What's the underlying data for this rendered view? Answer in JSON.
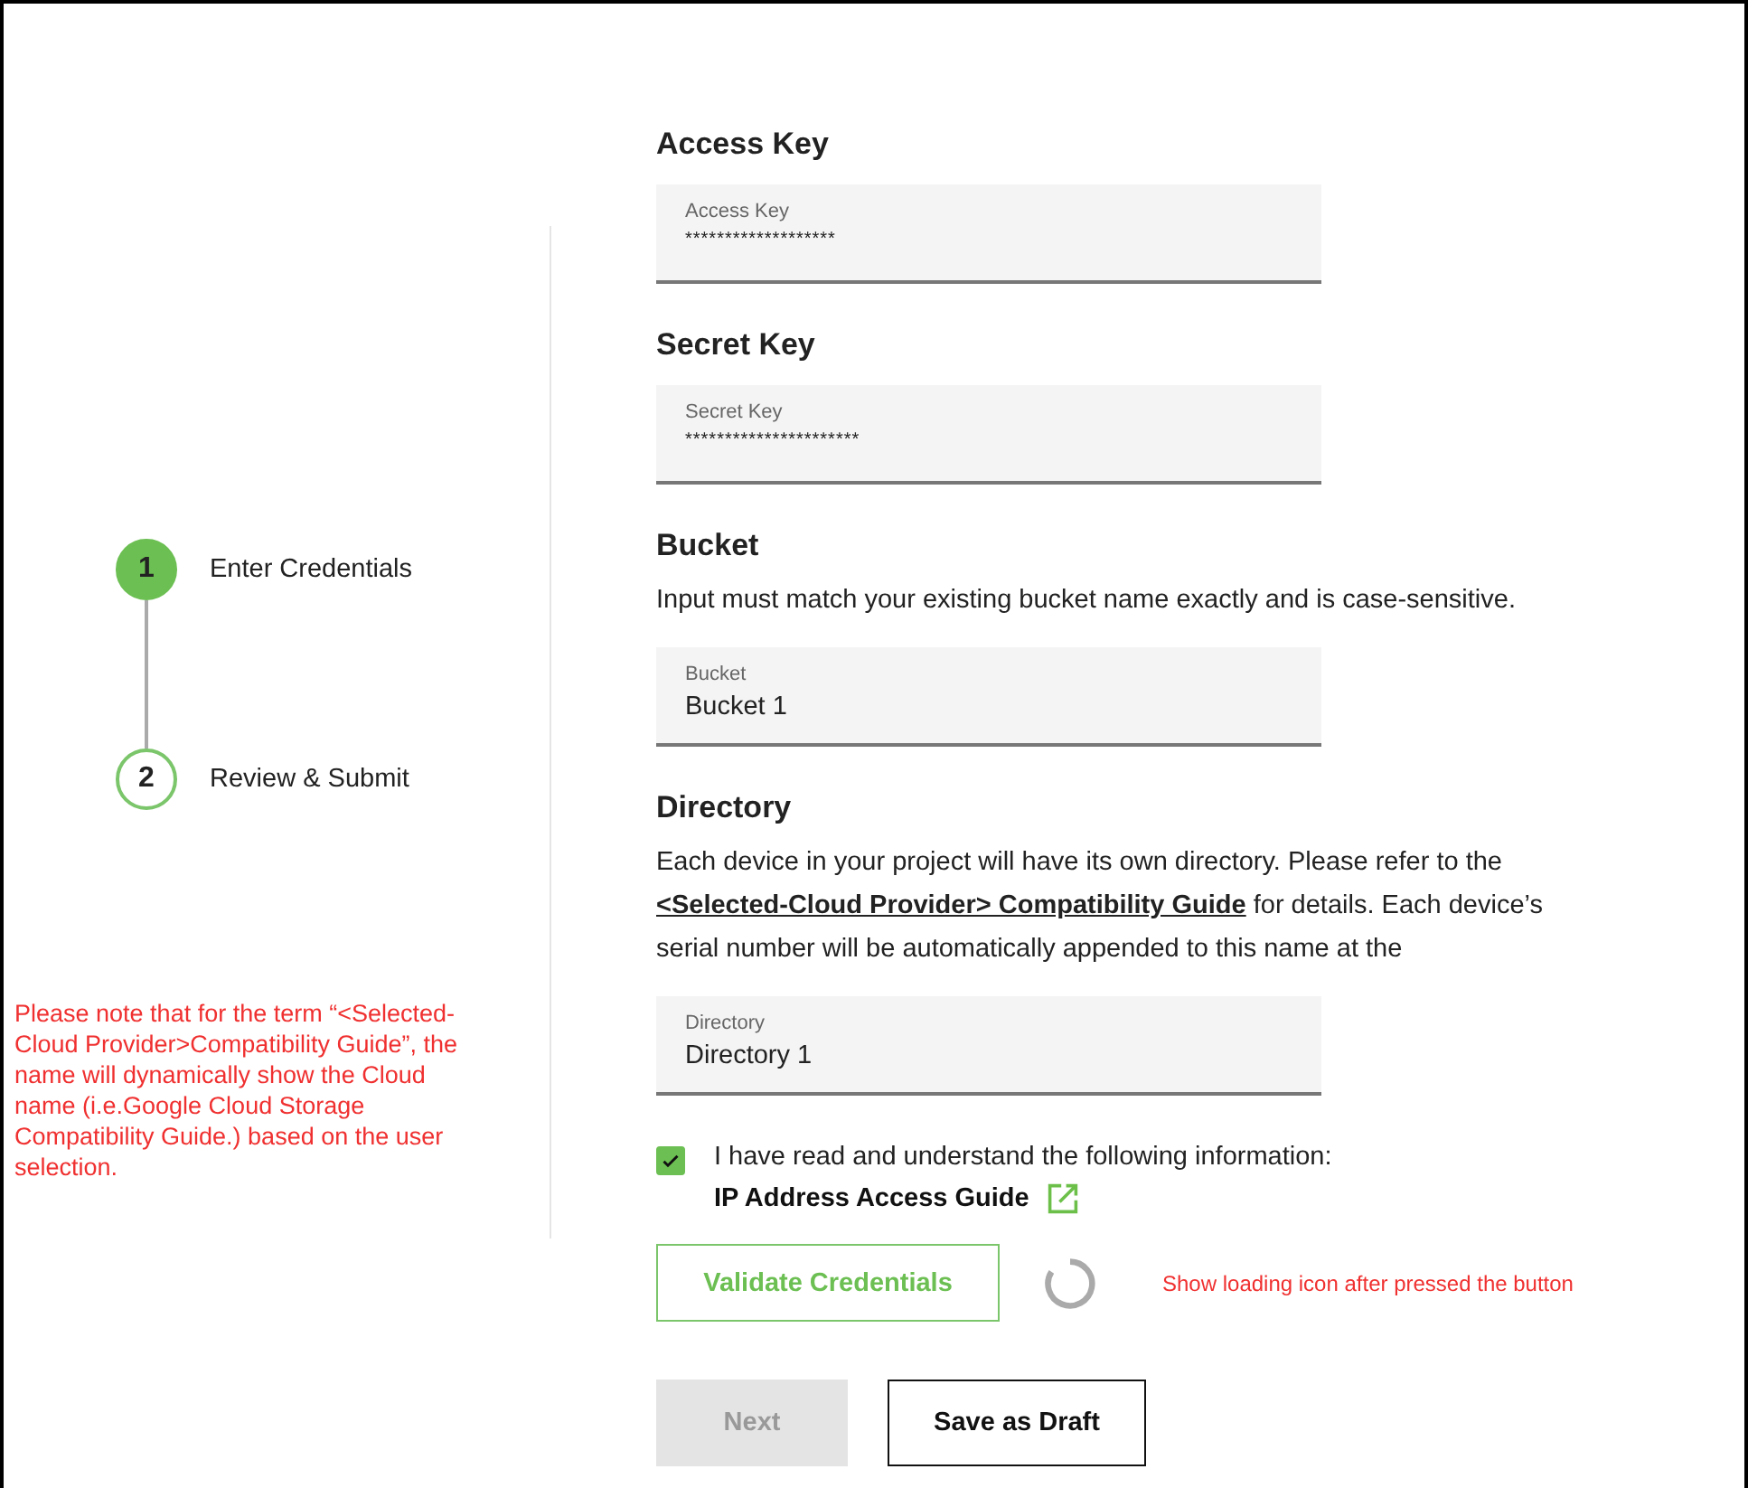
{
  "steps": [
    {
      "number": "1",
      "label": "Enter Credentials",
      "selected": true
    },
    {
      "number": "2",
      "label": "Review & Submit",
      "selected": false
    }
  ],
  "side_note": "Please note that for the term “<Selected-Cloud Provider>Compatibility Guide”, the name will dynamically show the Cloud name (i.e.Google Cloud Storage Compatibility Guide.)  based on the user selection.",
  "sections": [
    {
      "heading": "Access Key",
      "field": {
        "label": "Access Key",
        "value": "*******************",
        "masked": true
      }
    },
    {
      "heading": "Secret Key",
      "field": {
        "label": "Secret Key",
        "value": "**********************",
        "masked": true
      }
    },
    {
      "heading": "Bucket",
      "description": [
        {
          "kind": "text",
          "text": "Input must match your existing bucket name exactly and is case-sensitive."
        }
      ],
      "field": {
        "label": "Bucket",
        "value": "Bucket 1",
        "masked": false
      }
    },
    {
      "heading": "Directory",
      "description": [
        {
          "kind": "text",
          "text": "Each device in your project will have its own directory. Please refer to the "
        },
        {
          "kind": "link",
          "text": "<Selected-Cloud Provider> Compatibility Guide"
        },
        {
          "kind": "text",
          "text": " for details. Each device’s serial number will be automatically appended to this name at the"
        }
      ],
      "field": {
        "label": "Directory",
        "value": "Directory 1",
        "masked": false
      }
    }
  ],
  "consent": {
    "checked": true,
    "text": "I have read and understand the following information:",
    "link": "IP Address Access Guide"
  },
  "validate_button": "Validate Credentials",
  "loading_note": "Show loading icon after pressed the button",
  "buttons": [
    {
      "label": "Next",
      "disabled": true
    },
    {
      "label": "Save as Draft",
      "disabled": false
    }
  ]
}
